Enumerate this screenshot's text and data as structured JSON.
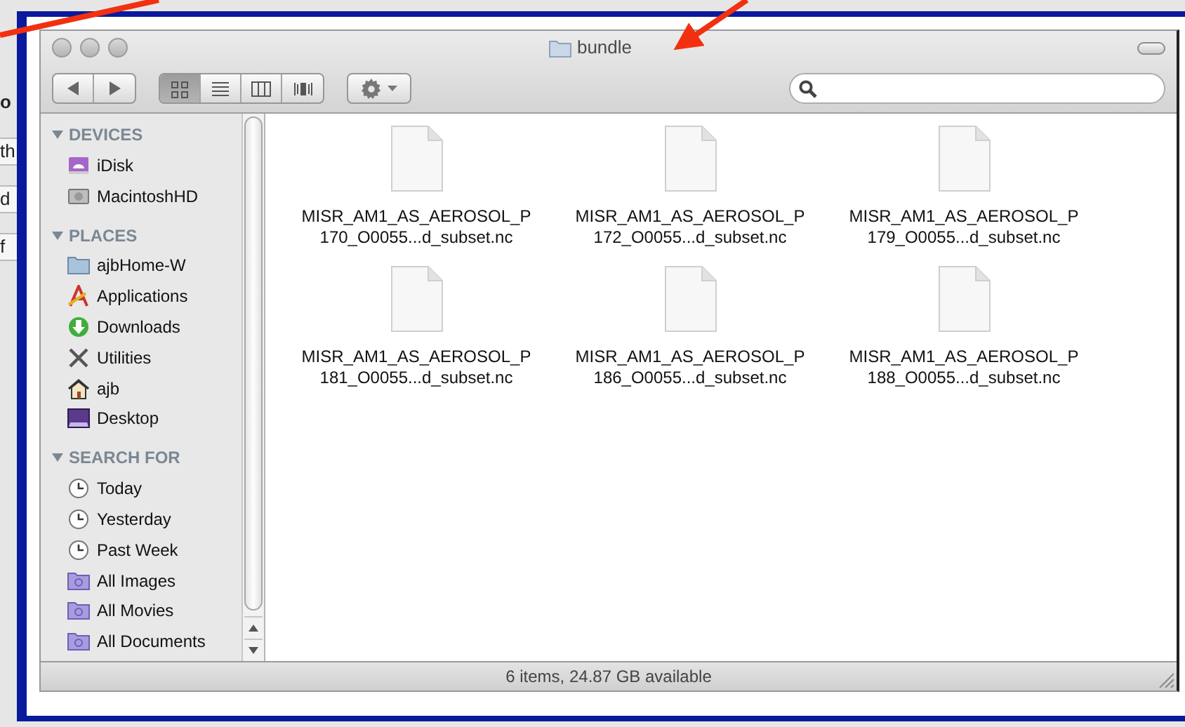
{
  "background_window": {
    "fragments": [
      "o",
      "th",
      "d",
      "f"
    ]
  },
  "window": {
    "title": "bundle"
  },
  "toolbar": {
    "view_buttons": [
      {
        "kind": "icons",
        "selected": true
      },
      {
        "kind": "list",
        "selected": false
      },
      {
        "kind": "columns",
        "selected": false
      },
      {
        "kind": "coverflow",
        "selected": false
      }
    ]
  },
  "sidebar": {
    "sections": [
      {
        "title": "DEVICES",
        "expanded": true,
        "items": [
          {
            "label": "iDisk",
            "kind": "idisk"
          },
          {
            "label": "MacintoshHD",
            "kind": "drive"
          }
        ]
      },
      {
        "title": "PLACES",
        "expanded": true,
        "items": [
          {
            "label": "ajbHome-W",
            "kind": "folder"
          },
          {
            "label": "Applications",
            "kind": "apps"
          },
          {
            "label": "Downloads",
            "kind": "downloads"
          },
          {
            "label": "Utilities",
            "kind": "utilities"
          },
          {
            "label": "ajb",
            "kind": "home"
          },
          {
            "label": "Desktop",
            "kind": "desktop"
          }
        ]
      },
      {
        "title": "SEARCH FOR",
        "expanded": true,
        "items": [
          {
            "label": "Today",
            "kind": "clock"
          },
          {
            "label": "Yesterday",
            "kind": "clock"
          },
          {
            "label": "Past Week",
            "kind": "clock"
          },
          {
            "label": "All Images",
            "kind": "smart"
          },
          {
            "label": "All Movies",
            "kind": "smart"
          },
          {
            "label": "All Documents",
            "kind": "smart"
          }
        ]
      }
    ]
  },
  "files": [
    {
      "lines": [
        "MISR_AM1_AS_AEROSOL_P",
        "170_O0055...d_subset.nc"
      ]
    },
    {
      "lines": [
        "MISR_AM1_AS_AEROSOL_P",
        "172_O0055...d_subset.nc"
      ]
    },
    {
      "lines": [
        "MISR_AM1_AS_AEROSOL_P",
        "179_O0055...d_subset.nc"
      ]
    },
    {
      "lines": [
        "MISR_AM1_AS_AEROSOL_P",
        "181_O0055...d_subset.nc"
      ]
    },
    {
      "lines": [
        "MISR_AM1_AS_AEROSOL_P",
        "186_O0055...d_subset.nc"
      ]
    },
    {
      "lines": [
        "MISR_AM1_AS_AEROSOL_P",
        "188_O0055...d_subset.nc"
      ]
    }
  ],
  "status_bar": "6 items, 24.87 GB available"
}
